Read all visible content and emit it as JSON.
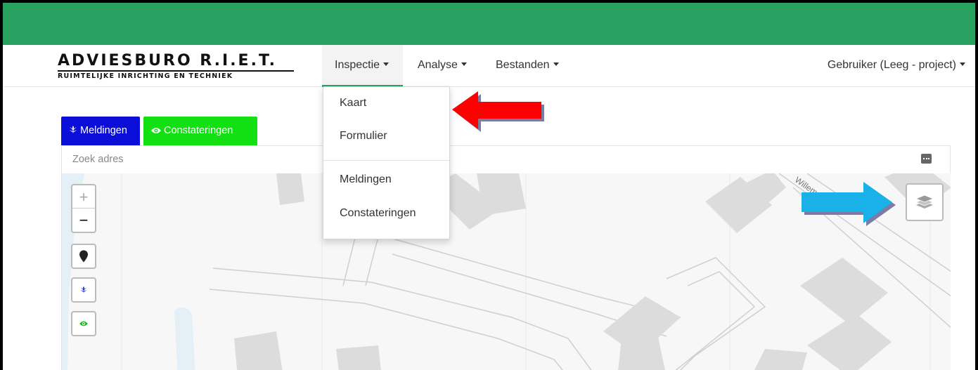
{
  "brand": {
    "name": "ADVIESBURO R.I.E.T.",
    "tagline": "RUIMTELIJKE INRICHTING EN TECHNIEK"
  },
  "nav": {
    "items": [
      {
        "label": "Inspectie",
        "active": true
      },
      {
        "label": "Analyse",
        "active": false
      },
      {
        "label": "Bestanden",
        "active": false
      }
    ],
    "user": "Gebruiker (Leeg - project)"
  },
  "dropdown": {
    "items": [
      "Kaart",
      "Formulier",
      "Meldingen",
      "Constateringen"
    ]
  },
  "tabs": {
    "meldingen": "Meldingen",
    "constateringen": "Constateringen"
  },
  "search": {
    "placeholder": "Zoek adres"
  },
  "map": {
    "street_label": "Willem",
    "controls": {
      "zoom_in": "+",
      "zoom_out": "−"
    }
  },
  "icons": {
    "dropdown_caret": "caret-down-icon",
    "meldingen": "grain-icon",
    "constateringen": "eye-icon",
    "location": "map-marker-icon",
    "layers": "layers-icon",
    "search": "more-icon"
  },
  "colors": {
    "header_green": "#27a060",
    "meldingen_blue": "#0a0ed8",
    "constateringen_green": "#13e012",
    "annotation_red": "#ff0000",
    "annotation_blue": "#1ab0e8"
  }
}
